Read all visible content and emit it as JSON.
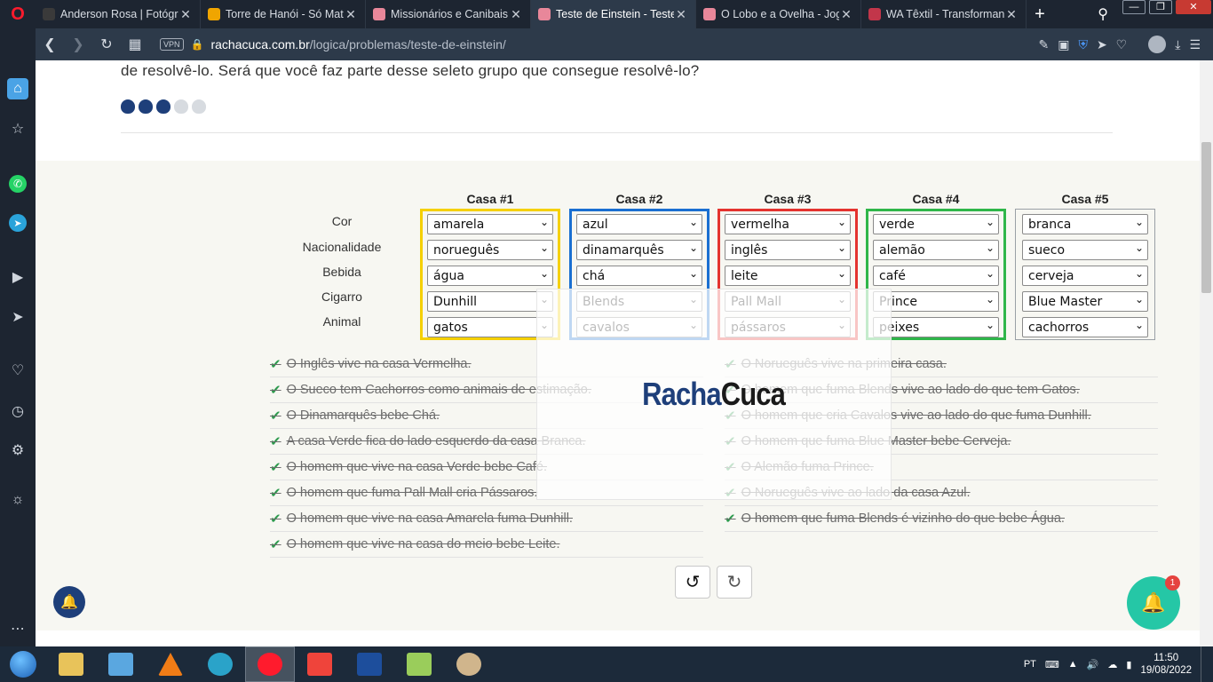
{
  "browser": {
    "tabs": [
      {
        "title": "Anderson Rosa | Fotógrafo",
        "favicon_color": "#3a3a3a",
        "active": false
      },
      {
        "title": "Torre de Hanói - Só Mate",
        "favicon_color": "#f0a500",
        "active": false
      },
      {
        "title": "Missionários e Canibais -",
        "favicon_color": "#e8879a",
        "active": false
      },
      {
        "title": "Teste de Einstein - Teste de",
        "favicon_color": "#e8879a",
        "active": true
      },
      {
        "title": "O Lobo e a Ovelha - Jogo",
        "favicon_color": "#e8879a",
        "active": false
      },
      {
        "title": "WA Têxtil - Transformand",
        "favicon_color": "#c2364a",
        "active": false
      }
    ],
    "url_host": "rachacuca.com.br",
    "url_path": "/logica/problemas/teste-de-einstein/",
    "vpn_label": "VPN"
  },
  "page": {
    "intro_text": "de resolvê-lo. Será que você faz parte desse seleto grupo que consegue resolvê-lo?",
    "difficulty": {
      "level": 3,
      "max": 5
    },
    "row_labels": [
      "Cor",
      "Nacionalidade",
      "Bebida",
      "Cigarro",
      "Animal"
    ],
    "houses": [
      {
        "title": "Casa #1",
        "border": "#f5d000",
        "values": [
          "amarela",
          "norueguês",
          "água",
          "Dunhill",
          "gatos"
        ]
      },
      {
        "title": "Casa #2",
        "border": "#1a6fd1",
        "values": [
          "azul",
          "dinamarquês",
          "chá",
          "Blends",
          "cavalos"
        ]
      },
      {
        "title": "Casa #3",
        "border": "#e4332f",
        "values": [
          "vermelha",
          "inglês",
          "leite",
          "Pall Mall",
          "pássaros"
        ]
      },
      {
        "title": "Casa #4",
        "border": "#2fb64a",
        "values": [
          "verde",
          "alemão",
          "café",
          "Prince",
          "peixes"
        ]
      },
      {
        "title": "Casa #5",
        "border": "#9aa0a6",
        "values": [
          "branca",
          "sueco",
          "cerveja",
          "Blue Master",
          "cachorros"
        ]
      }
    ],
    "clues_left": [
      "O Inglês vive na casa Vermelha.",
      "O Sueco tem Cachorros como animais de estimação.",
      "O Dinamarquês bebe Chá.",
      "A casa Verde fica do lado esquerdo da casa Branca.",
      "O homem que vive na casa Verde bebe Café.",
      "O homem que fuma Pall Mall cria Pássaros.",
      "O homem que vive na casa Amarela fuma Dunhill.",
      "O homem que vive na casa do meio bebe Leite."
    ],
    "clues_right": [
      "O Norueguês vive na primeira casa.",
      "O homem que fuma Blends vive ao lado do que tem Gatos.",
      "O homem que cria Cavalos vive ao lado do que fuma Dunhill.",
      "O homem que fuma Blue Master bebe Cerveja.",
      "O Alemão fuma Prince.",
      "O Norueguês vive ao lado da casa Azul.",
      "O homem que fuma Blends é vizinho do que bebe Água."
    ],
    "logo_part1": "Racha",
    "logo_part2": "Cuca",
    "notification_count": "1"
  },
  "taskbar": {
    "lang": "PT",
    "time": "11:50",
    "date": "19/08/2022"
  }
}
